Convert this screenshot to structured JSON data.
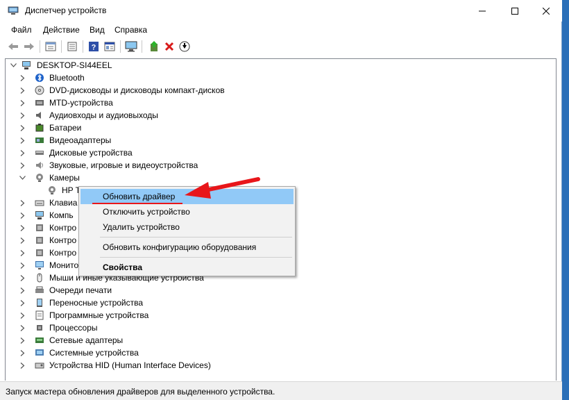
{
  "window": {
    "title": "Диспетчер устройств"
  },
  "menu": [
    "Файл",
    "Действие",
    "Вид",
    "Справка"
  ],
  "toolbar": {
    "buttons": [
      "back-icon",
      "forward-icon",
      "properties-icon",
      "list-icon",
      "help-icon",
      "details-icon",
      "monitor-icon",
      "update-driver-icon",
      "uninstall-icon",
      "download-icon"
    ]
  },
  "tree": {
    "root": "DESKTOP-SI44EEL",
    "categories": [
      {
        "label": "Bluetooth",
        "icon": "bluetooth-icon"
      },
      {
        "label": "DVD-дисководы и дисководы компакт-дисков",
        "icon": "dvd-icon"
      },
      {
        "label": "MTD-устройства",
        "icon": "mtd-icon"
      },
      {
        "label": "Аудиовходы и аудиовыходы",
        "icon": "audio-icon"
      },
      {
        "label": "Батареи",
        "icon": "battery-icon"
      },
      {
        "label": "Видеоадаптеры",
        "icon": "display-adapter-icon"
      },
      {
        "label": "Дисковые устройства",
        "icon": "disk-icon"
      },
      {
        "label": "Звуковые, игровые и видеоустройства",
        "icon": "sound-icon"
      },
      {
        "label": "Камеры",
        "icon": "camera-icon"
      },
      {
        "label": "HP T",
        "icon": "webcam-icon"
      },
      {
        "label": "Клавиа",
        "icon": "keyboard-icon"
      },
      {
        "label": "Компь",
        "icon": "computer-icon"
      },
      {
        "label": "Контро",
        "icon": "controller-icon"
      },
      {
        "label": "Контро",
        "icon": "controller-icon"
      },
      {
        "label": "Контро",
        "icon": "controller-icon"
      },
      {
        "label": "Монито",
        "icon": "monitor-icon"
      },
      {
        "label": "Мыши и иные указывающие устройства",
        "icon": "mouse-icon"
      },
      {
        "label": "Очереди печати",
        "icon": "printer-icon"
      },
      {
        "label": "Переносные устройства",
        "icon": "portable-icon"
      },
      {
        "label": "Программные устройства",
        "icon": "software-device-icon"
      },
      {
        "label": "Процессоры",
        "icon": "cpu-icon"
      },
      {
        "label": "Сетевые адаптеры",
        "icon": "network-icon"
      },
      {
        "label": "Системные устройства",
        "icon": "system-icon"
      },
      {
        "label": "Устройства HID (Human Interface Devices)",
        "icon": "hid-icon"
      }
    ]
  },
  "context_menu": {
    "items": [
      "Обновить драйвер",
      "Отключить устройство",
      "Удалить устройство",
      "Обновить конфигурацию оборудования",
      "Свойства"
    ]
  },
  "status": {
    "text": "Запуск мастера обновления драйверов для выделенного устройства."
  },
  "colors": {
    "highlight": "#91c9f7",
    "arrow": "#e8161a",
    "desktop": "#2a6fb8"
  }
}
